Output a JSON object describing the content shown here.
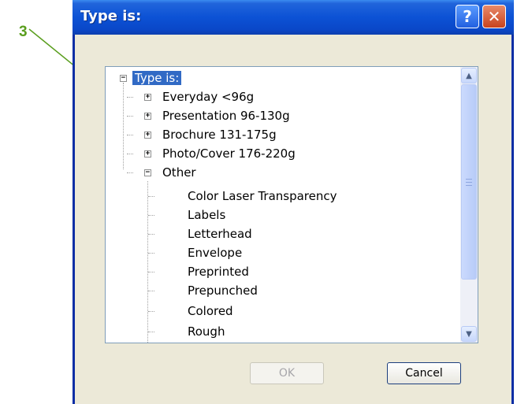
{
  "callout": {
    "number": "3",
    "color": "#5a9e1e"
  },
  "window": {
    "title": "Type is:",
    "help_label": "?",
    "close_label": "✕"
  },
  "tree": {
    "root": {
      "label": "Type is:",
      "expanded": true,
      "selected": true
    },
    "groups": [
      {
        "label": "Everyday <96g",
        "expanded": false
      },
      {
        "label": "Presentation 96-130g",
        "expanded": false
      },
      {
        "label": "Brochure 131-175g",
        "expanded": false
      },
      {
        "label": "Photo/Cover 176-220g",
        "expanded": false
      },
      {
        "label": "Other",
        "expanded": true
      }
    ],
    "other_children": [
      "Color Laser Transparency",
      "Labels",
      "Letterhead",
      "Envelope",
      "Preprinted",
      "Prepunched",
      "Colored",
      "Rough"
    ]
  },
  "buttons": {
    "ok": {
      "label": "OK",
      "enabled": false
    },
    "cancel": {
      "label": "Cancel",
      "enabled": true
    }
  },
  "colors": {
    "titlebar": "#0a47c8",
    "selection": "#316ac5",
    "dialog_bg": "#ece9d8"
  }
}
